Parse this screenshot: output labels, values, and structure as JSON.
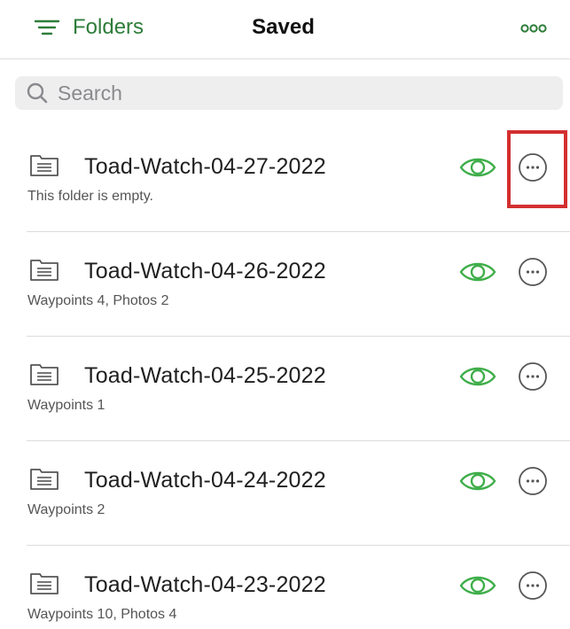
{
  "header": {
    "folders_label": "Folders",
    "title": "Saved",
    "menu_icon": "filter-lines-icon",
    "more_icon": "three-dots-icon"
  },
  "search": {
    "placeholder": "Search",
    "value": "",
    "icon": "search-icon"
  },
  "folders": [
    {
      "name": "Toad-Watch-04-27-2022",
      "subtitle": "This folder is empty."
    },
    {
      "name": "Toad-Watch-04-26-2022",
      "subtitle": "Waypoints 4, Photos 2"
    },
    {
      "name": "Toad-Watch-04-25-2022",
      "subtitle": "Waypoints 1"
    },
    {
      "name": "Toad-Watch-04-24-2022",
      "subtitle": "Waypoints 2"
    },
    {
      "name": "Toad-Watch-04-23-2022",
      "subtitle": "Waypoints 10, Photos 4"
    }
  ],
  "colors": {
    "accent_green": "#2e7d3a",
    "eye_green": "#3fae4a",
    "highlight_red": "#d32f2f",
    "search_bg": "#eeeeef"
  }
}
